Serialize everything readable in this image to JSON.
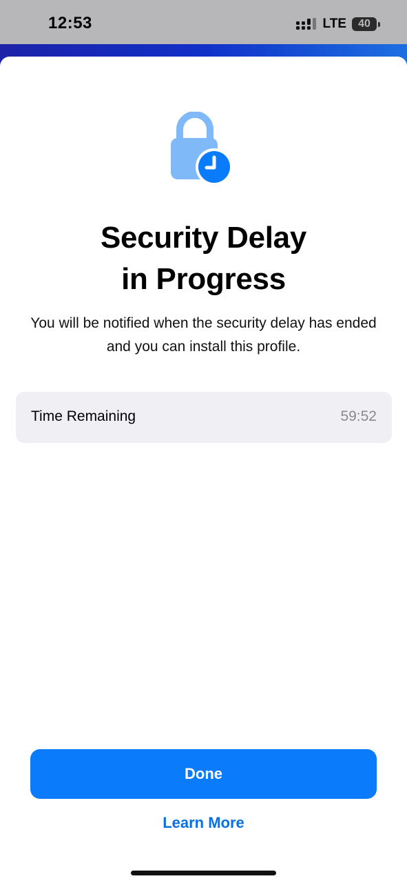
{
  "status_bar": {
    "time": "12:53",
    "network": "LTE",
    "battery": "40"
  },
  "hero": {
    "icon": "lock-clock-icon",
    "colors": {
      "lock": "#7fb9f7",
      "clock": "#0a7bfb"
    }
  },
  "sheet": {
    "title_line1": "Security Delay",
    "title_line2": "in Progress",
    "description": "You will be notified when the security delay has ended and you can install this profile.",
    "time_remaining": {
      "label": "Time Remaining",
      "value": "59:52"
    },
    "done_label": "Done",
    "learn_more_label": "Learn More"
  },
  "colors": {
    "accent": "#0a7bfb",
    "status_bar_bg": "#b7b7b9",
    "row_bg": "#f0f0f4"
  }
}
